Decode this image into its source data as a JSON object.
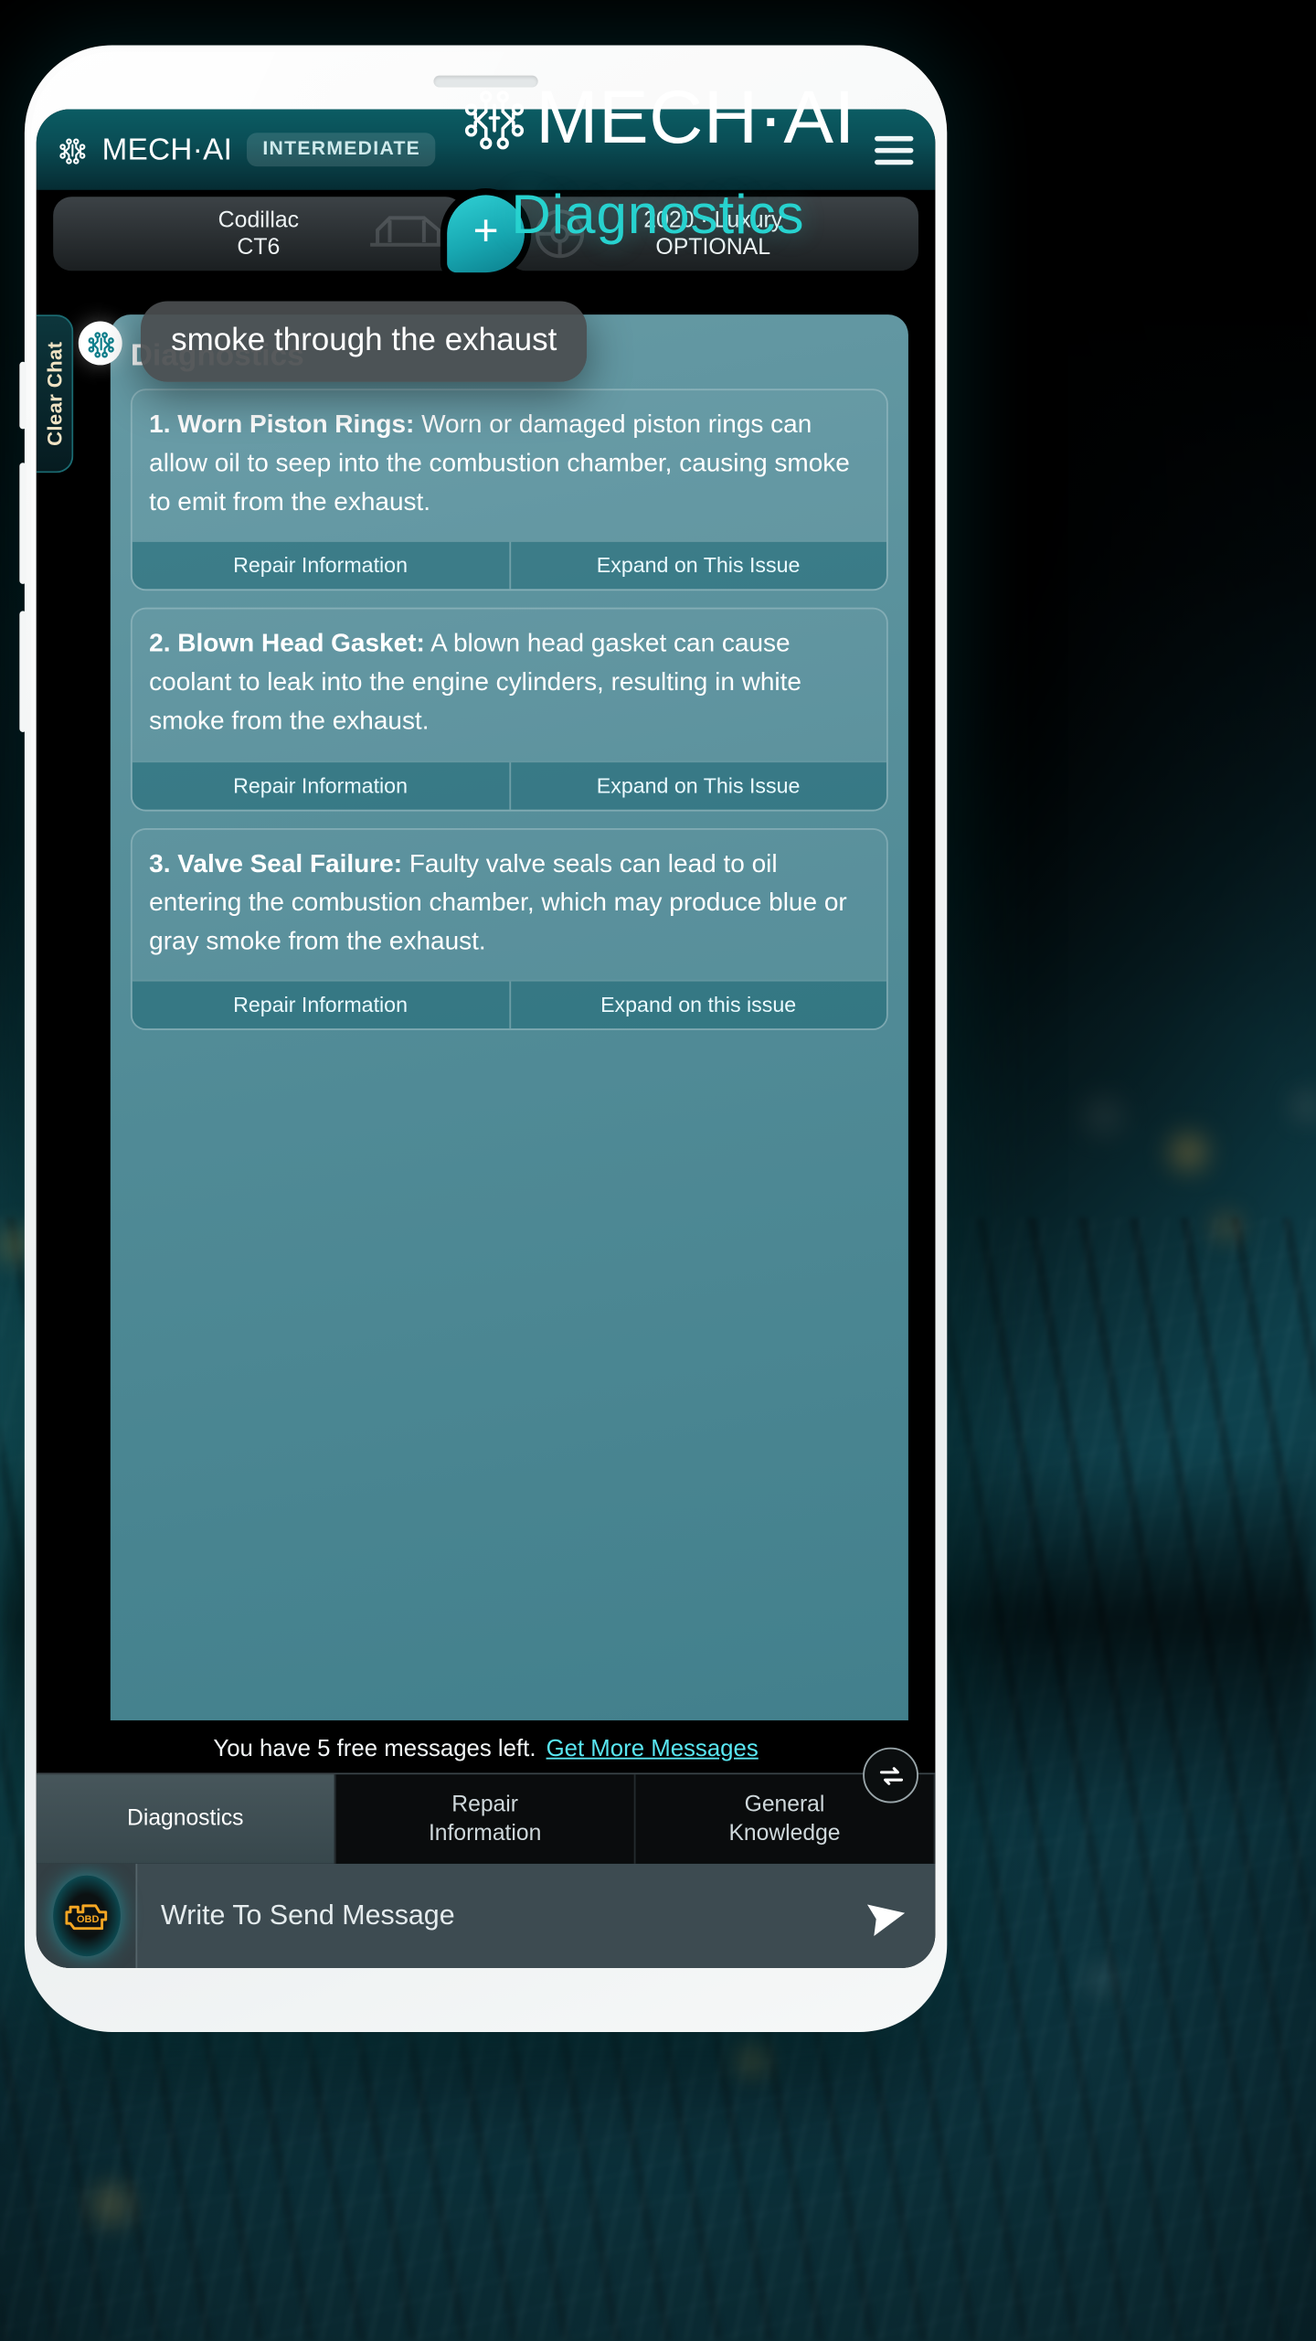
{
  "brand": {
    "name": "MECH·AI",
    "logo_icon": "circuit-node-icon",
    "page_title": "Diagnostics"
  },
  "app": {
    "header": {
      "brand": "MECH·AI",
      "logo_icon": "circuit-node-icon",
      "level_badge": "INTERMEDIATE",
      "menu_icon": "hamburger-menu-icon"
    },
    "vehicle": {
      "left_line1": "Codillac",
      "left_line2": "CT6",
      "right_line1": "2020 · Luxury",
      "right_line2": "OPTIONAL",
      "add_icon": "plus-icon"
    },
    "chat": {
      "clear_chat_label": "Clear Chat",
      "avatar_icon": "circuit-node-icon",
      "message_title": "Diagnostics",
      "tooltip_text": "smoke through the exhaust",
      "issues": [
        {
          "number": "1.",
          "heading": "Worn Piston Rings:",
          "body": "Worn or damaged piston rings can allow oil to seep into the combustion chamber, causing smoke to emit from the exhaust.",
          "action_left": "Repair Information",
          "action_right": "Expand on This Issue"
        },
        {
          "number": "2.",
          "heading": "Blown Head Gasket:",
          "body": "A blown head gasket can cause coolant to leak into the engine cylinders, resulting in white smoke from the exhaust.",
          "action_left": "Repair Information",
          "action_right": "Expand on This Issue"
        },
        {
          "number": "3.",
          "heading": "Valve Seal Failure:",
          "body": "Faulty valve seals can lead to oil entering the combustion chamber, which may produce blue or gray smoke from the exhaust.",
          "action_left": "Repair Information",
          "action_right": "Expand on this issue"
        }
      ]
    },
    "notice": {
      "text": "You have 5 free messages left.",
      "link": "Get More Messages"
    },
    "tabs": [
      {
        "label": "Diagnostics",
        "active": true
      },
      {
        "label": "Repair\nInformation",
        "active": false
      },
      {
        "label": "General\nKnowledge",
        "active": false
      }
    ],
    "refresh_icon": "refresh-loop-icon",
    "composer": {
      "obd_icon": "obd-engine-icon",
      "obd_label": "OBD",
      "placeholder": "Write To Send Message",
      "value": "",
      "send_icon": "send-paper-plane-icon"
    }
  },
  "colors": {
    "accent_teal": "#27d2cf",
    "header_teal": "#0b5c63",
    "card_slate": "#6aa0ab",
    "link_cyan": "#59e7f2",
    "obd_amber": "#f5a623"
  }
}
